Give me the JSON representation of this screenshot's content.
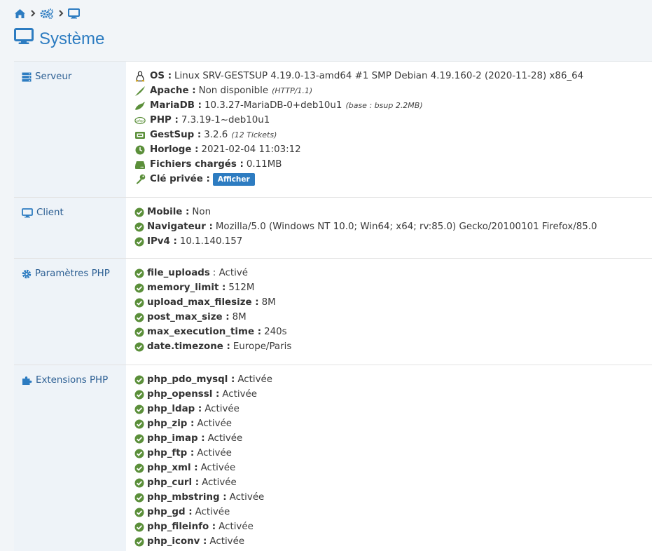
{
  "title": "Système",
  "sections": {
    "server": {
      "label": "Serveur",
      "items": {
        "os": {
          "key": "OS :",
          "value": "Linux SRV-GESTSUP 4.19.0-13-amd64 #1 SMP Debian 4.19.160-2 (2020-11-28) x86_64"
        },
        "apache": {
          "key": "Apache :",
          "value": "Non disponible",
          "note": "(HTTP/1.1)"
        },
        "mariadb": {
          "key": "MariaDB :",
          "value": "10.3.27-MariaDB-0+deb10u1",
          "note": "(base : bsup 2.2MB)"
        },
        "php": {
          "key": "PHP :",
          "value": "7.3.19-1~deb10u1"
        },
        "gestsup": {
          "key": "GestSup :",
          "value": "3.2.6",
          "note": "(12 Tickets)"
        },
        "clock": {
          "key": "Horloge :",
          "value": "2021-02-04 11:03:12"
        },
        "files": {
          "key": "Fichiers chargés :",
          "value": "0.11MB"
        },
        "key": {
          "key": "Clé privée :",
          "button": "Afficher"
        }
      }
    },
    "client": {
      "label": "Client",
      "items": [
        {
          "key": "Mobile :",
          "value": "Non"
        },
        {
          "key": "Navigateur :",
          "value": "Mozilla/5.0 (Windows NT 10.0; Win64; x64; rv:85.0) Gecko/20100101 Firefox/85.0"
        },
        {
          "key": "IPv4 :",
          "value": "10.1.140.157"
        }
      ]
    },
    "php_params": {
      "label": "Paramètres PHP",
      "items": [
        {
          "key": "file_uploads",
          "value": ": Activé"
        },
        {
          "key": "memory_limit :",
          "value": "512M"
        },
        {
          "key": "upload_max_filesize :",
          "value": "8M"
        },
        {
          "key": "post_max_size :",
          "value": "8M"
        },
        {
          "key": "max_execution_time :",
          "value": "240s"
        },
        {
          "key": "date.timezone :",
          "value": "Europe/Paris"
        }
      ]
    },
    "php_ext": {
      "label": "Extensions PHP",
      "items": [
        {
          "key": "php_pdo_mysql :",
          "value": "Activée"
        },
        {
          "key": "php_openssl :",
          "value": "Activée"
        },
        {
          "key": "php_ldap :",
          "value": "Activée"
        },
        {
          "key": "php_zip :",
          "value": "Activée"
        },
        {
          "key": "php_imap :",
          "value": "Activée"
        },
        {
          "key": "php_ftp :",
          "value": "Activée"
        },
        {
          "key": "php_xml :",
          "value": "Activée"
        },
        {
          "key": "php_curl :",
          "value": "Activée"
        },
        {
          "key": "php_mbstring :",
          "value": "Activée"
        },
        {
          "key": "php_gd :",
          "value": "Activée"
        },
        {
          "key": "php_fileinfo :",
          "value": "Activée"
        },
        {
          "key": "php_iconv :",
          "value": "Activée"
        }
      ]
    }
  },
  "colors": {
    "accent": "#2d7cc1",
    "ok": "#5b8f3a",
    "label_bg": "#eef3f8"
  }
}
